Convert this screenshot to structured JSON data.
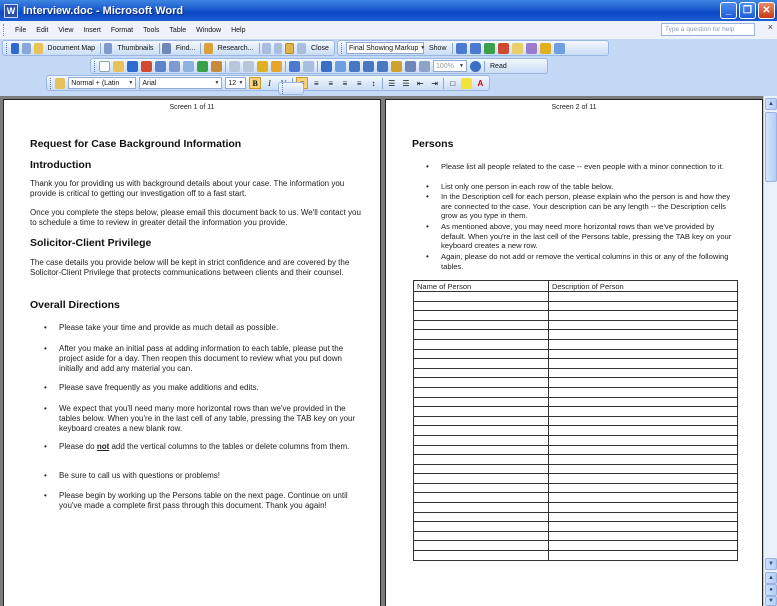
{
  "window": {
    "title": "Interview.doc - Microsoft Word",
    "minimize": "_",
    "maximize": "❐",
    "close": "✕"
  },
  "menu": {
    "items": [
      "File",
      "Edit",
      "View",
      "Insert",
      "Format",
      "Tools",
      "Table",
      "Window",
      "Help"
    ],
    "help_placeholder": "Type a question for help",
    "close_doc": "×"
  },
  "toolbar1": {
    "document_map": "Document Map",
    "thumbnails": "Thumbnails",
    "find": "Find...",
    "research": "Research...",
    "close": "Close",
    "markup_combo": "Final Showing Markup",
    "show": "Show"
  },
  "toolbar2": {
    "zoom": "100%",
    "read": "Read"
  },
  "formatting": {
    "style": "Normal + (Latin",
    "font": "Arial",
    "size": "12",
    "bold": "B",
    "italic": "I",
    "underline": "U"
  },
  "page1": {
    "screen_label": "Screen 1 of 11",
    "title": "Request for Case Background Information",
    "intro_heading": "Introduction",
    "intro_p1": "Thank you for providing us with background details about your case.  The information you provide is critical to getting our investigation off to a fast start.",
    "intro_p2": "Once you complete the steps below, please email this document back to us.  We'll contact you to schedule a time to review in greater detail the information you provide.",
    "privilege_heading": "Solicitor-Client Privilege",
    "privilege_p": "The case details you provide below will be kept in strict confidence and are covered by the Solicitor-Client Privilege that protects communications between clients and their counsel.",
    "directions_heading": "Overall Directions",
    "bullets": [
      "Please take your time and provide as much detail as possible.",
      "After you make an initial pass at adding information to each table, please put the project aside for a day.  Then reopen this document to review what you put down initially and add any material you can.",
      "Please save frequently as you make additions and edits.",
      "We expect that you'll need many more horizontal rows than we've provided in the tables below.  When you're in the last cell of any table, pressing the TAB key on your keyboard creates a new blank row.",
      "add the vertical columns to the tables or delete columns from them.",
      "Be sure to call us with questions or problems!",
      "Please begin by working up the Persons table on the next page.  Continue on until you've made a complete first pass through this document.  Thank you again!"
    ],
    "bullet5_prefix": "Please do ",
    "bullet5_emph": "not"
  },
  "page2": {
    "screen_label": "Screen 2 of 11",
    "heading": "Persons",
    "bullets": [
      "Please list all people related to the case -- even people with a minor connection to it.",
      "List only one person in each row of the table below.",
      "In the Description cell for each person, please explain who the person is and how they are connected to the case.  Your description can be any length -- the Description cells grow as you type in them.",
      "As mentioned above, you may need more horizontal rows than we've provided by default.  When you're in the last cell of the Persons table, pressing the TAB key on your keyboard creates a new row.",
      "Again, please do not add or remove the vertical columns in this or any of the following tables."
    ],
    "table": {
      "columns": [
        "Name of Person",
        "Description of Person"
      ],
      "empty_rows": 28
    }
  },
  "icons": {
    "toolbar_colors": [
      "#2f6ad0",
      "#d04a2f",
      "#2c9a3c",
      "#e0b020",
      "#7a4fc4",
      "#c33"
    ]
  }
}
